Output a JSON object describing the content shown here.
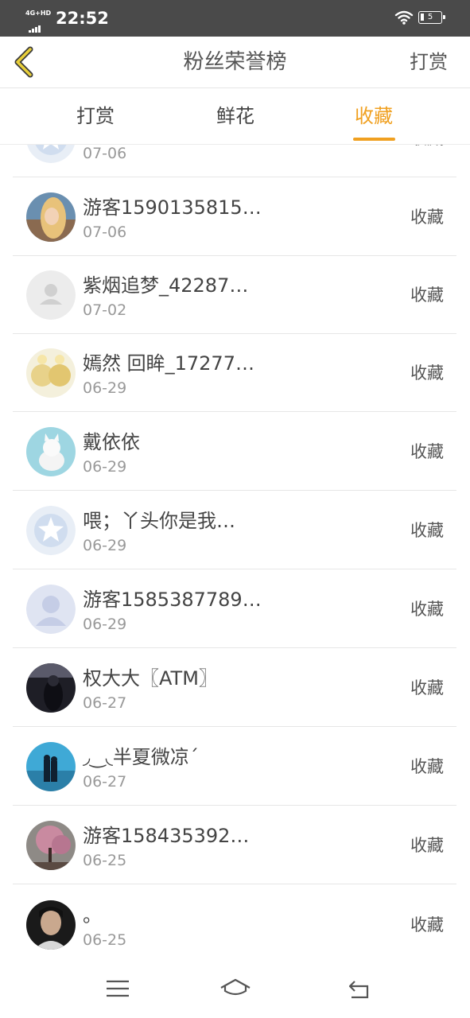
{
  "status_bar": {
    "network": "4G+HD",
    "time": "22:52",
    "battery": "5",
    "wifi_icon": "wifi-icon"
  },
  "header": {
    "title": "粉丝荣誉榜",
    "action": "打赏",
    "back_icon": "back-chevron-icon"
  },
  "tabs": [
    {
      "label": "打赏",
      "active": false
    },
    {
      "label": "鲜花",
      "active": false
    },
    {
      "label": "收藏",
      "active": true
    }
  ],
  "rows": [
    {
      "name": "",
      "date": "07-06",
      "action": "收藏",
      "avatar": "qzone-logo"
    },
    {
      "name": "游客1590135815…",
      "date": "07-06",
      "action": "收藏",
      "avatar": "photo-blonde-girl"
    },
    {
      "name": "紫烟追梦_42287…",
      "date": "07-02",
      "action": "收藏",
      "avatar": "default-user"
    },
    {
      "name": "嫣然 回眸_17277…",
      "date": "06-29",
      "action": "收藏",
      "avatar": "photo-lion-cubs"
    },
    {
      "name": "戴依依",
      "date": "06-29",
      "action": "收藏",
      "avatar": "photo-white-kitten"
    },
    {
      "name": "喂；丫头你是我…",
      "date": "06-29",
      "action": "收藏",
      "avatar": "qzone-logo"
    },
    {
      "name": "游客1585387789…",
      "date": "06-29",
      "action": "收藏",
      "avatar": "default-user-blue"
    },
    {
      "name": "权大大〖ATM〗",
      "date": "06-27",
      "action": "收藏",
      "avatar": "photo-dark-figure"
    },
    {
      "name": "◞‿◟半夏微凉ˊ",
      "date": "06-27",
      "action": "收藏",
      "avatar": "photo-couple-sea"
    },
    {
      "name": "游客158435392…",
      "date": "06-25",
      "action": "收藏",
      "avatar": "photo-cherry-tree"
    },
    {
      "name": "。",
      "date": "06-25",
      "action": "收藏",
      "avatar": "photo-man-portrait"
    }
  ],
  "bottom_nav": [
    "menu-icon",
    "home-icon",
    "back-icon"
  ],
  "colors": {
    "accent": "#f0a020",
    "status_bar": "#4a4a4a",
    "text": "#444444",
    "subtext": "#999999"
  }
}
